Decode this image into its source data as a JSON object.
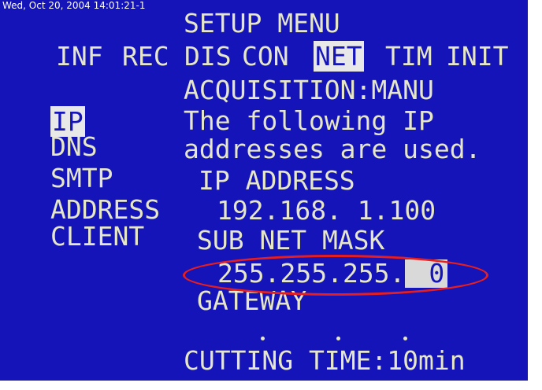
{
  "timestamp": "Wed, Oct 20, 2004 14:01:21-1",
  "menu": {
    "title": "SETUP MENU",
    "tabs": [
      "INF",
      "REC",
      "DIS",
      "CON",
      "NET",
      "TIM",
      "INIT"
    ],
    "active_tab": "NET"
  },
  "sidebar": {
    "items": [
      "IP",
      "DNS",
      "SMTP",
      "ADDRESS",
      "CLIENT"
    ],
    "selected": "IP"
  },
  "content": {
    "acquisition": "ACQUISITION:MANU",
    "info_line1": "The following IP",
    "info_line2": "addresses are used.",
    "ip_label": "IP ADDRESS",
    "ip_value": "192.168.  1.100",
    "subnet_label": "SUB NET MASK",
    "subnet_prefix": "255.255.255.",
    "subnet_last": "0",
    "gateway_label": "GATEWAY",
    "cutting_time": "CUTTING TIME:10min"
  },
  "colors": {
    "background": "#1414b8",
    "text": "#e6e6c8",
    "highlight": "#e8e8e8",
    "annotation": "#e81e1e"
  }
}
